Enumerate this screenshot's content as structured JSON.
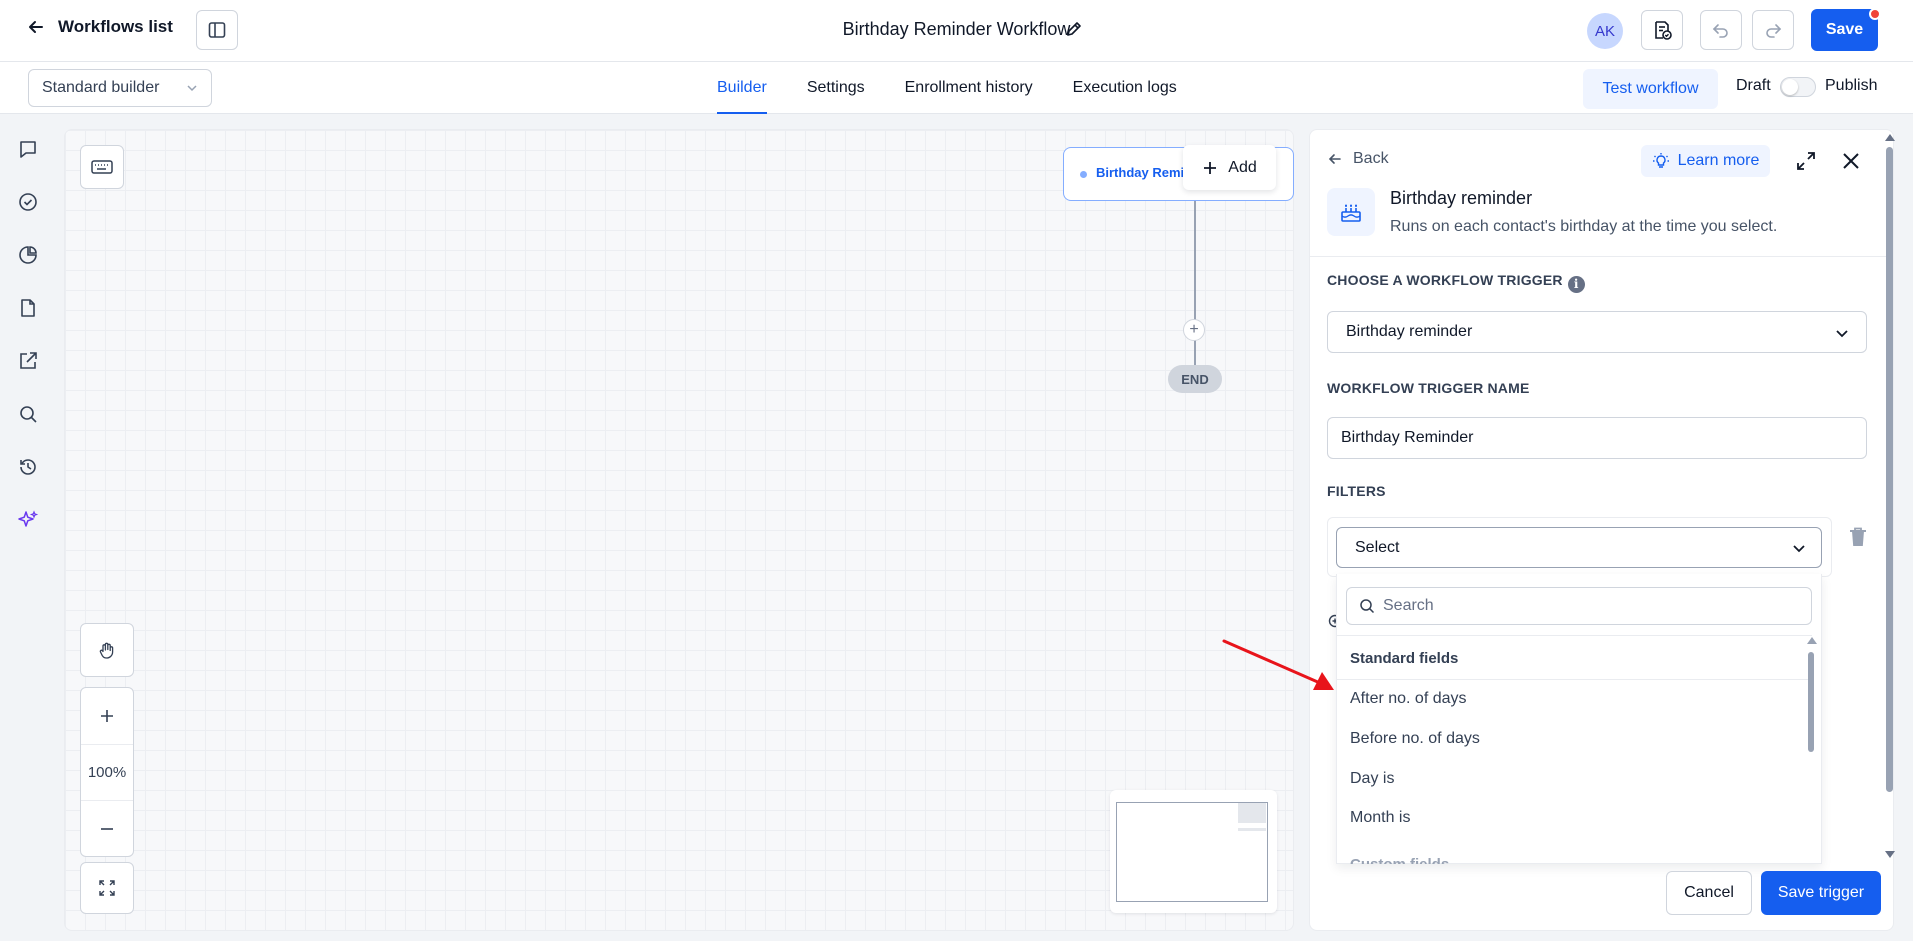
{
  "header": {
    "back_label": "Workflows list",
    "workflow_title": "Birthday Reminder Workflow",
    "avatar_initials": "AK",
    "save_label": "Save"
  },
  "subbar": {
    "builder_mode": "Standard builder",
    "tabs": [
      {
        "label": "Builder",
        "active": true
      },
      {
        "label": "Settings",
        "active": false
      },
      {
        "label": "Enrollment history",
        "active": false
      },
      {
        "label": "Execution logs",
        "active": false
      }
    ],
    "test_label": "Test workflow",
    "draft_label": "Draft",
    "publish_label": "Publish",
    "publish_enabled": false
  },
  "rail": {
    "icons": [
      "chat-icon",
      "check-circle-icon",
      "pie-chart-icon",
      "document-icon",
      "external-link-icon",
      "search-icon",
      "history-icon",
      "sparkles-icon"
    ]
  },
  "canvas": {
    "trigger_node_label": "Birthday Reminder",
    "add_label": "Add",
    "end_label": "END",
    "zoom_level": "100%"
  },
  "panel": {
    "back_label": "Back",
    "learn_more_label": "Learn more",
    "trigger_title": "Birthday reminder",
    "trigger_description": "Runs on each contact's birthday at the time you select.",
    "choose_trigger_label": "CHOOSE A WORKFLOW TRIGGER",
    "trigger_type_value": "Birthday reminder",
    "trigger_name_label": "WORKFLOW TRIGGER NAME",
    "trigger_name_value": "Birthday Reminder",
    "filters_label": "FILTERS",
    "filter_select_value": "Select",
    "cancel_label": "Cancel",
    "save_trigger_label": "Save trigger"
  },
  "dropdown": {
    "search_placeholder": "Search",
    "group_label": "Standard fields",
    "items": [
      "After no. of days",
      "Before no. of days",
      "Day is",
      "Month is"
    ],
    "next_group_label": "Custom fields"
  },
  "colors": {
    "primary": "#155eef",
    "primary_light": "#eff4ff",
    "arrow": "#e8141b",
    "notification": "#f04438"
  }
}
